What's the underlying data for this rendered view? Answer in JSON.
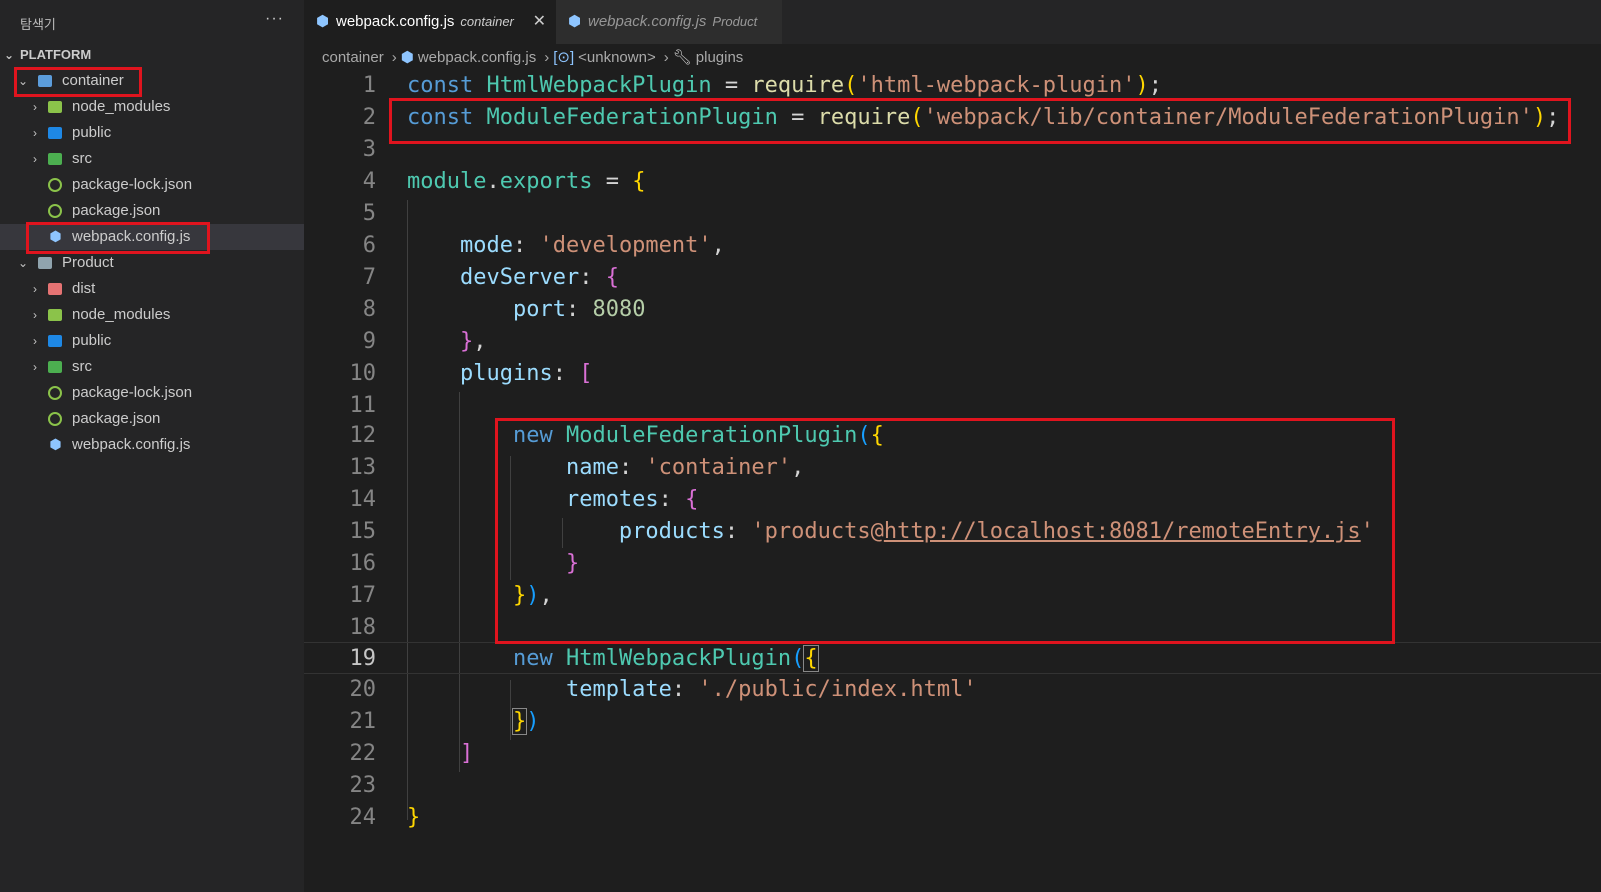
{
  "sidebar": {
    "title": "탐색기",
    "more": "···",
    "root": "PLATFORM",
    "items": [
      {
        "label": "container",
        "icon": "folder-open-icon"
      },
      {
        "label": "node_modules",
        "icon": "folder-icon"
      },
      {
        "label": "public",
        "icon": "folder-icon"
      },
      {
        "label": "src",
        "icon": "folder-icon"
      },
      {
        "label": "package-lock.json",
        "icon": "json-file-icon"
      },
      {
        "label": "package.json",
        "icon": "json-file-icon"
      },
      {
        "label": "webpack.config.js",
        "icon": "webpack-file-icon"
      },
      {
        "label": "Product",
        "icon": "folder-open-icon"
      },
      {
        "label": "dist",
        "icon": "folder-icon"
      },
      {
        "label": "node_modules",
        "icon": "folder-icon"
      },
      {
        "label": "public",
        "icon": "folder-icon"
      },
      {
        "label": "src",
        "icon": "folder-icon"
      },
      {
        "label": "package-lock.json",
        "icon": "json-file-icon"
      },
      {
        "label": "package.json",
        "icon": "json-file-icon"
      },
      {
        "label": "webpack.config.js",
        "icon": "webpack-file-icon"
      }
    ]
  },
  "tabs": [
    {
      "label": "webpack.config.js",
      "description": "container",
      "close": "✕"
    },
    {
      "label": "webpack.config.js",
      "description": "Product"
    }
  ],
  "breadcrumb": [
    "container",
    "webpack.config.js",
    "<unknown>",
    "plugins"
  ],
  "editor": {
    "current_line": 19,
    "lines": [
      "1",
      "2",
      "3",
      "4",
      "5",
      "6",
      "7",
      "8",
      "9",
      "10",
      "11",
      "12",
      "13",
      "14",
      "15",
      "16",
      "17",
      "18",
      "19",
      "20",
      "21",
      "22",
      "23",
      "24"
    ],
    "code": {
      "l1_kw": "const",
      "l1_cls": "HtmlWebpackPlugin",
      "l1_eq": " = ",
      "l1_fn": "require",
      "l1_str": "'html-webpack-plugin'",
      "l2_kw": "const",
      "l2_cls": "ModuleFederationPlugin",
      "l2_eq": " = ",
      "l2_fn": "require",
      "l2_str": "'webpack/lib/container/ModuleFederationPlugin'",
      "l4_var": "module",
      "l4_prop": "exports",
      "l6_prop": "mode",
      "l6_str": "'development'",
      "l7_prop": "devServer",
      "l8_prop": "port",
      "l8_num": "8080",
      "l10_prop": "plugins",
      "l12_kw": "new",
      "l12_cls": "ModuleFederationPlugin",
      "l13_prop": "name",
      "l13_str": "'container'",
      "l14_prop": "remotes",
      "l15_prop": "products",
      "l15_str_a": "'products@",
      "l15_str_b": "http://localhost:8081/remoteEntry.js",
      "l15_str_c": "'",
      "l19_kw": "new",
      "l19_cls": "HtmlWebpackPlugin",
      "l20_prop": "template",
      "l20_str": "'./public/index.html'"
    }
  },
  "colors": {
    "annotation": "#e0141e",
    "background": "#1e1e1e",
    "sidebar": "#252526"
  }
}
